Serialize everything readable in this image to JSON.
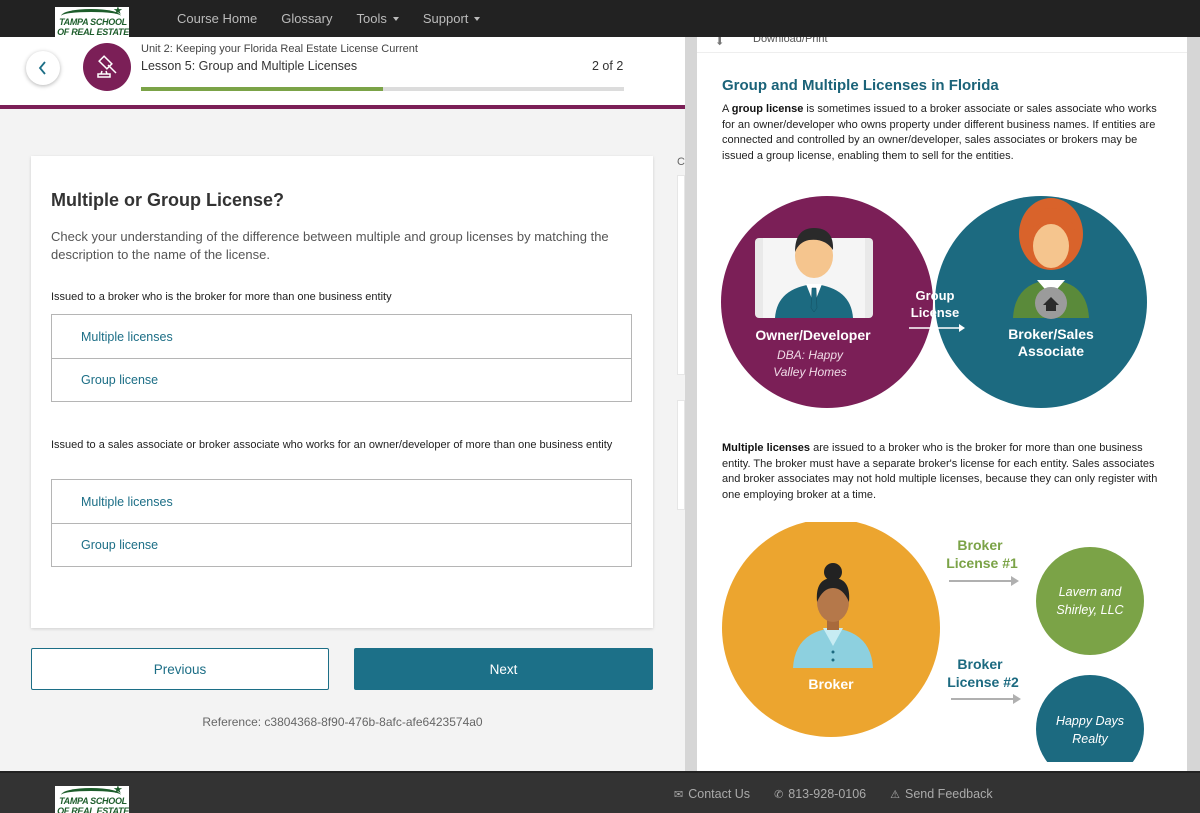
{
  "brand": {
    "logo_line1": "TAMPA SCHOOL",
    "logo_line2": "OF REAL ESTATE"
  },
  "nav": {
    "items": [
      {
        "label": "Course Home",
        "dropdown": false
      },
      {
        "label": "Glossary",
        "dropdown": false
      },
      {
        "label": "Tools",
        "dropdown": true
      },
      {
        "label": "Support",
        "dropdown": true
      }
    ]
  },
  "lesson": {
    "unit": "Unit 2: Keeping your Florida Real Estate License Current",
    "title": "Lesson 5: Group and Multiple Licenses",
    "page_indicator": "2 of 2",
    "progress_fraction": 0.5,
    "icon": "gavel-icon",
    "colors": {
      "accent": "#7b1f57",
      "progress": "#7ba347",
      "link": "#1c6e86"
    }
  },
  "question": {
    "title": "Multiple or Group License?",
    "intro": "Check your understanding of the difference between multiple and group licenses by matching the description to the name of the license.",
    "items": [
      {
        "prompt": "Issued to a broker who is the broker for more than one business entity",
        "options": [
          "Multiple licenses",
          "Group license"
        ]
      },
      {
        "prompt": "Issued to a sales associate or broker associate who works for an owner/developer of more than one business entity",
        "options": [
          "Multiple licenses",
          "Group license"
        ]
      }
    ]
  },
  "buttons": {
    "previous": "Previous",
    "next": "Next"
  },
  "reference": "Reference: c3804368-8f90-476b-8afc-afe6423574a0",
  "sidebar_stub": {
    "label": "C"
  },
  "right_panel": {
    "download_label": "Download/Print",
    "title": "Group and Multiple Licenses in Florida",
    "group_para_bold": "group license",
    "group_para_prefix": "A ",
    "group_para_rest": " is sometimes issued to a broker associate or sales associate who works for an owner/developer who owns property under different business names. If entities are connected and controlled by an owner/developer, sales associates or brokers may be issued a group license, enabling them to sell for the entities.",
    "venn": {
      "left_label": "Owner/Developer",
      "left_sub1": "DBA: Happy",
      "left_sub2": "Valley Homes",
      "center_line1": "Group",
      "center_line2": "License",
      "right_line1": "Broker/Sales",
      "right_line2": "Associate"
    },
    "multi_para_bold": "Multiple licenses",
    "multi_para_rest": " are issued to a broker who is the broker for more than one business entity. The broker must have a separate broker's license for each entity. Sales associates and broker associates may not hold multiple licenses, because they can only register with one employing broker at a time.",
    "broker_diagram": {
      "broker_label": "Broker",
      "license1_line1": "Broker",
      "license1_line2": "License #1",
      "entity1_line1": "Lavern and",
      "entity1_line2": "Shirley, LLC",
      "license2_line1": "Broker",
      "license2_line2": "License #2",
      "entity2_line1": "Happy Days",
      "entity2_line2": "Realty"
    }
  },
  "footer": {
    "links": [
      {
        "icon": "envelope-icon",
        "label": "Contact Us"
      },
      {
        "icon": "phone-icon",
        "label": "813-928-0106"
      },
      {
        "icon": "warning-icon",
        "label": "Send Feedback"
      }
    ]
  }
}
